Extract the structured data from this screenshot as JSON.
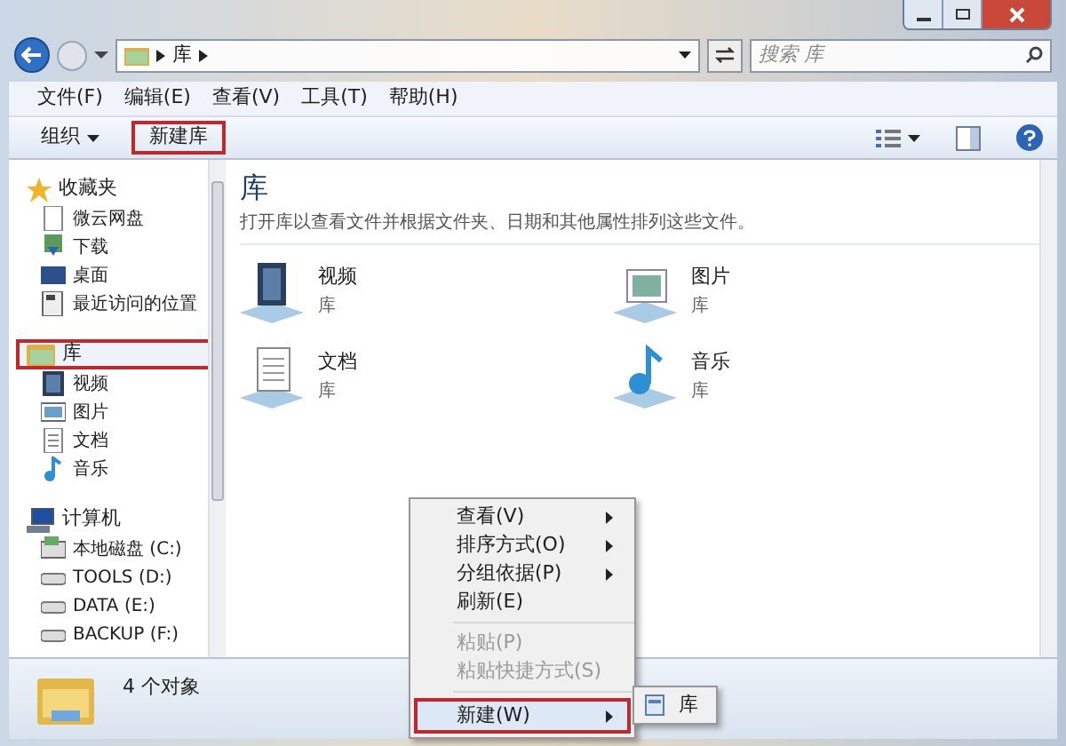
{
  "address_bar": {
    "path": [
      "库"
    ],
    "search_placeholder": "搜索 库"
  },
  "menu_bar": [
    "文件(F)",
    "编辑(E)",
    "查看(V)",
    "工具(T)",
    "帮助(H)"
  ],
  "toolbar": [
    {
      "label": "组织",
      "dropdown": true,
      "highlighted": false
    },
    {
      "label": "新建库",
      "dropdown": false,
      "highlighted": true
    }
  ],
  "sidebar": [
    {
      "label": "收藏夹",
      "highlighted": false,
      "children": [
        {
          "label": "微云网盘"
        },
        {
          "label": "下载"
        },
        {
          "label": "桌面"
        },
        {
          "label": "最近访问的位置"
        }
      ]
    },
    {
      "label": "库",
      "highlighted": true,
      "children": [
        {
          "label": "视频"
        },
        {
          "label": "图片"
        },
        {
          "label": "文档"
        },
        {
          "label": "音乐"
        }
      ]
    },
    {
      "label": "计算机",
      "highlighted": false,
      "children": [
        {
          "label": "本地磁盘 (C:)"
        },
        {
          "label": "TOOLS (D:)"
        },
        {
          "label": "DATA (E:)"
        },
        {
          "label": "BACKUP (F:)"
        }
      ]
    }
  ],
  "content": {
    "title": "库",
    "description": "打开库以查看文件并根据文件夹、日期和其他属性排列这些文件。",
    "items": [
      {
        "name": "视频",
        "type": "库"
      },
      {
        "name": "图片",
        "type": "库"
      },
      {
        "name": "文档",
        "type": "库"
      },
      {
        "name": "音乐",
        "type": "库"
      }
    ]
  },
  "status_bar": {
    "text": "4 个对象"
  },
  "context_menu": {
    "items": [
      {
        "kind": "item",
        "label": "查看(V)",
        "submenu": true,
        "disabled": false,
        "highlighted": false
      },
      {
        "kind": "item",
        "label": "排序方式(O)",
        "submenu": true,
        "disabled": false,
        "highlighted": false
      },
      {
        "kind": "item",
        "label": "分组依据(P)",
        "submenu": true,
        "disabled": false,
        "highlighted": false
      },
      {
        "kind": "item",
        "label": "刷新(E)",
        "submenu": false,
        "disabled": false,
        "highlighted": false
      },
      {
        "kind": "separator"
      },
      {
        "kind": "item",
        "label": "粘贴(P)",
        "submenu": false,
        "disabled": true,
        "highlighted": false
      },
      {
        "kind": "item",
        "label": "粘贴快捷方式(S)",
        "submenu": false,
        "disabled": true,
        "highlighted": false
      },
      {
        "kind": "separator"
      },
      {
        "kind": "item",
        "label": "新建(W)",
        "submenu": true,
        "disabled": false,
        "highlighted": true
      }
    ],
    "submenu": [
      {
        "label": "库"
      }
    ]
  }
}
